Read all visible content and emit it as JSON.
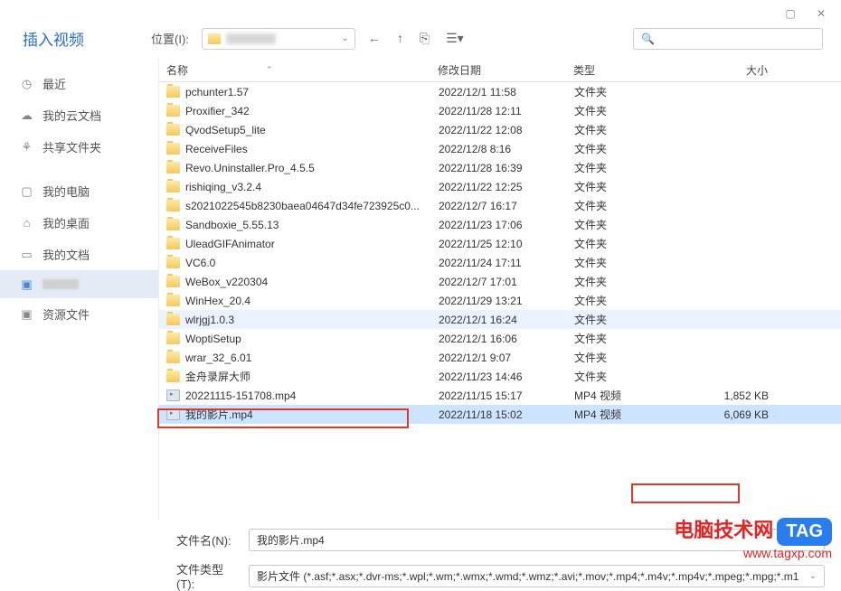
{
  "window": {
    "title": "插入视频"
  },
  "toolbar": {
    "location_label": "位置(I):",
    "search_placeholder": ""
  },
  "sidebar": {
    "items": [
      {
        "label": "最近",
        "icon": "clock"
      },
      {
        "label": "我的云文档",
        "icon": "cloud"
      },
      {
        "label": "共享文件夹",
        "icon": "share"
      },
      {
        "label": "我的电脑",
        "icon": "monitor"
      },
      {
        "label": "我的桌面",
        "icon": "desktop"
      },
      {
        "label": "我的文档",
        "icon": "doc"
      },
      {
        "label": "",
        "icon": "folder",
        "blurred": true,
        "selected": true
      },
      {
        "label": "资源文件",
        "icon": "folder"
      }
    ]
  },
  "columns": {
    "name": "名称",
    "date": "修改日期",
    "type": "类型",
    "size": "大小"
  },
  "files": [
    {
      "name": "pchunter1.57",
      "date": "2022/12/1 11:58",
      "type": "文件夹",
      "size": "",
      "kind": "folder"
    },
    {
      "name": "Proxifier_342",
      "date": "2022/11/28 12:11",
      "type": "文件夹",
      "size": "",
      "kind": "folder"
    },
    {
      "name": "QvodSetup5_lite",
      "date": "2022/11/22 12:08",
      "type": "文件夹",
      "size": "",
      "kind": "folder"
    },
    {
      "name": "ReceiveFiles",
      "date": "2022/12/8 8:16",
      "type": "文件夹",
      "size": "",
      "kind": "folder"
    },
    {
      "name": "Revo.Uninstaller.Pro_4.5.5",
      "date": "2022/11/28 16:39",
      "type": "文件夹",
      "size": "",
      "kind": "folder"
    },
    {
      "name": "rishiqing_v3.2.4",
      "date": "2022/11/22 12:25",
      "type": "文件夹",
      "size": "",
      "kind": "folder"
    },
    {
      "name": "s2021022545b8230baea04647d34fe723925c0...",
      "date": "2022/12/7 16:17",
      "type": "文件夹",
      "size": "",
      "kind": "folder"
    },
    {
      "name": "Sandboxie_5.55.13",
      "date": "2022/11/23 17:06",
      "type": "文件夹",
      "size": "",
      "kind": "folder"
    },
    {
      "name": "UleadGIFAnimator",
      "date": "2022/11/25 12:10",
      "type": "文件夹",
      "size": "",
      "kind": "folder"
    },
    {
      "name": "VC6.0",
      "date": "2022/11/24 17:11",
      "type": "文件夹",
      "size": "",
      "kind": "folder"
    },
    {
      "name": "WeBox_v220304",
      "date": "2022/12/7 17:01",
      "type": "文件夹",
      "size": "",
      "kind": "folder"
    },
    {
      "name": "WinHex_20.4",
      "date": "2022/11/29 13:21",
      "type": "文件夹",
      "size": "",
      "kind": "folder"
    },
    {
      "name": "wlrjgj1.0.3",
      "date": "2022/12/1 16:24",
      "type": "文件夹",
      "size": "",
      "kind": "folder",
      "hover": true
    },
    {
      "name": "WoptiSetup",
      "date": "2022/12/1 16:06",
      "type": "文件夹",
      "size": "",
      "kind": "folder"
    },
    {
      "name": "wrar_32_6.01",
      "date": "2022/12/1 9:07",
      "type": "文件夹",
      "size": "",
      "kind": "folder"
    },
    {
      "name": "金舟录屏大师",
      "date": "2022/11/23 14:46",
      "type": "文件夹",
      "size": "",
      "kind": "folder"
    },
    {
      "name": "20221115-151708.mp4",
      "date": "2022/11/15 15:17",
      "type": "MP4 视频",
      "size": "1,852 KB",
      "kind": "video"
    },
    {
      "name": "我的影片.mp4",
      "date": "2022/11/18 15:02",
      "type": "MP4 视频",
      "size": "6,069 KB",
      "kind": "video",
      "selected": true
    }
  ],
  "bottom": {
    "filename_label": "文件名(N):",
    "filename_value": "我的影片.mp4",
    "filetype_label": "文件类型(T):",
    "filetype_value": "影片文件 (*.asf;*.asx;*.dvr-ms;*.wpl;*.wm;*.wmx;*.wmd;*.wmz;*.avi;*.mov;*.mp4;*.m4v;*.mp4v;*.mpeg;*.mpg;*.m1"
  },
  "watermark": {
    "line1": "电脑技术网",
    "line2": "www.tagxp.com",
    "tag": "TAG"
  }
}
